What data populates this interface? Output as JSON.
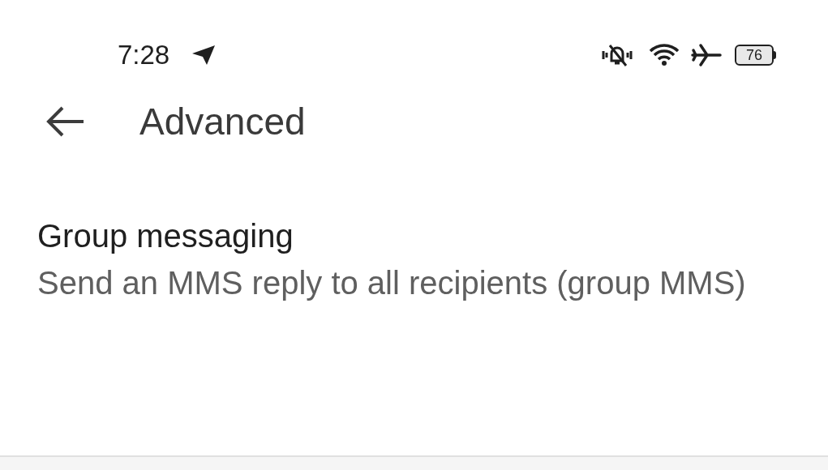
{
  "status_bar": {
    "time": "7:28",
    "battery": "76"
  },
  "app_bar": {
    "title": "Advanced"
  },
  "settings": [
    {
      "title": "Group messaging",
      "summary": "Send an MMS reply to all recipients (group MMS)"
    }
  ]
}
